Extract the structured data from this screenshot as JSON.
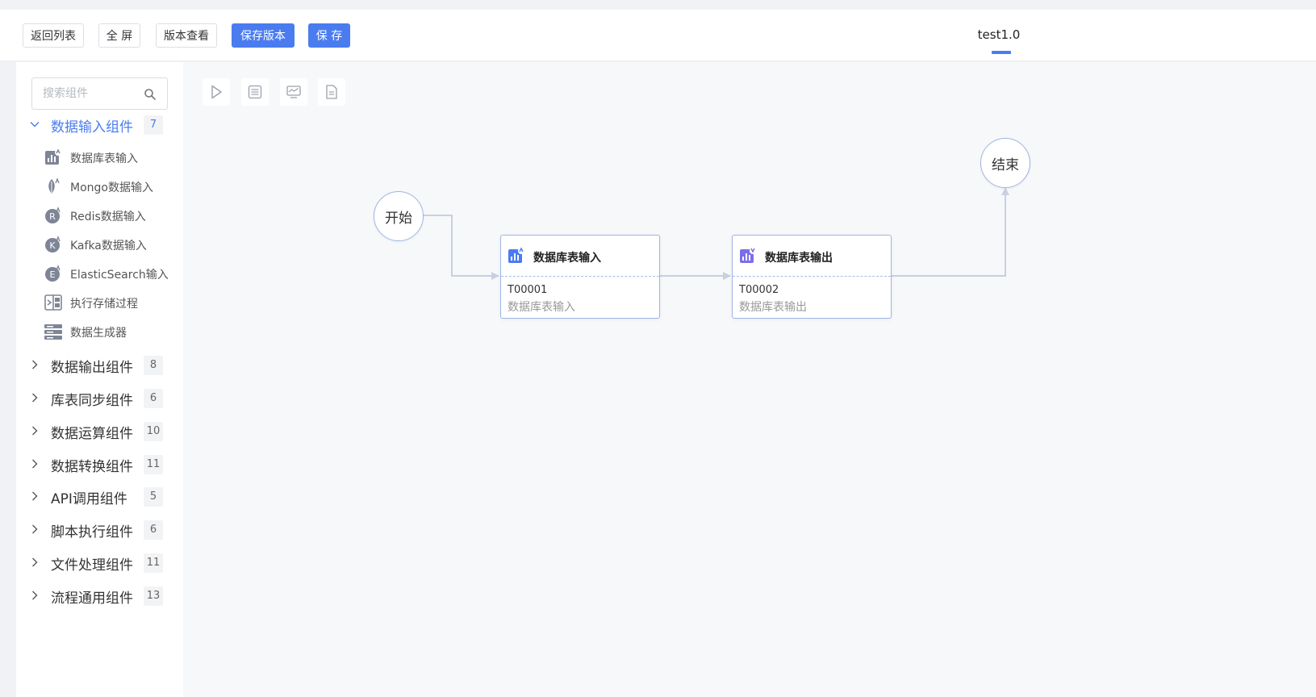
{
  "toolbar": {
    "back": "返回列表",
    "fullscreen": "全 屏",
    "versions": "版本查看",
    "save_version": "保存版本",
    "save": "保 存"
  },
  "tab": {
    "title": "test1.0"
  },
  "colors": {
    "primary": "#4a7cf0",
    "icon_grey": "#7e8596",
    "output_icon": "#7b6ee8"
  },
  "search": {
    "placeholder": "搜索组件"
  },
  "categories": [
    {
      "label": "数据输入组件",
      "count": "7",
      "expanded": true,
      "items": [
        {
          "label": "数据库表输入",
          "icon": "db-input-icon"
        },
        {
          "label": "Mongo数据输入",
          "icon": "mongo-icon"
        },
        {
          "label": "Redis数据输入",
          "icon": "redis-icon"
        },
        {
          "label": "Kafka数据输入",
          "icon": "kafka-icon"
        },
        {
          "label": "ElasticSearch输入",
          "icon": "elasticsearch-icon"
        },
        {
          "label": "执行存储过程",
          "icon": "stored-procedure-icon"
        },
        {
          "label": "数据生成器",
          "icon": "data-generator-icon"
        }
      ]
    },
    {
      "label": "数据输出组件",
      "count": "8",
      "expanded": false
    },
    {
      "label": "库表同步组件",
      "count": "6",
      "expanded": false
    },
    {
      "label": "数据运算组件",
      "count": "10",
      "expanded": false
    },
    {
      "label": "数据转换组件",
      "count": "11",
      "expanded": false
    },
    {
      "label": "API调用组件",
      "count": "5",
      "expanded": false
    },
    {
      "label": "脚本执行组件",
      "count": "6",
      "expanded": false
    },
    {
      "label": "文件处理组件",
      "count": "11",
      "expanded": false
    },
    {
      "label": "流程通用组件",
      "count": "13",
      "expanded": false
    }
  ],
  "canvas_tools": [
    "run-icon",
    "list-icon",
    "monitor-icon",
    "document-icon"
  ],
  "flow": {
    "start": {
      "label": "开始"
    },
    "end": {
      "label": "结束"
    },
    "nodes": [
      {
        "title": "数据库表输入",
        "code": "T00001",
        "desc": "数据库表输入"
      },
      {
        "title": "数据库表输出",
        "code": "T00002",
        "desc": "数据库表输出"
      }
    ]
  }
}
